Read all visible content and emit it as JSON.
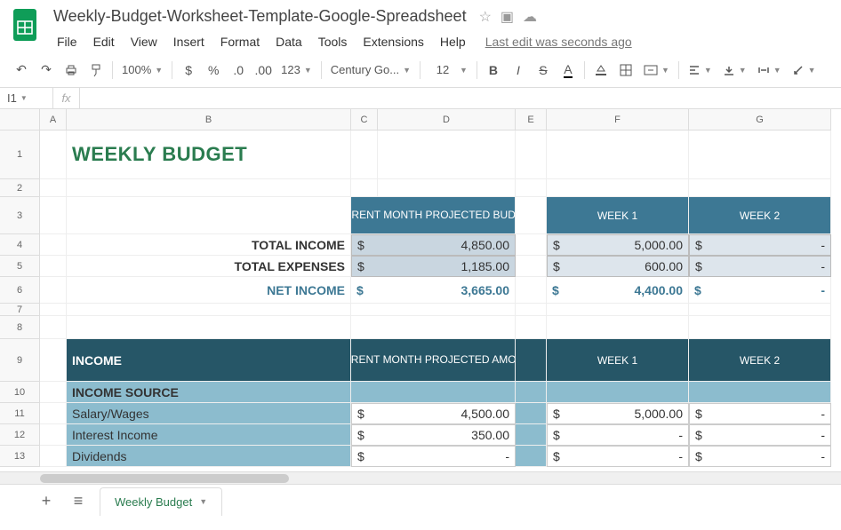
{
  "doc": {
    "title": "Weekly-Budget-Worksheet-Template-Google-Spreadsheet"
  },
  "menu": {
    "file": "File",
    "edit": "Edit",
    "view": "View",
    "insert": "Insert",
    "format": "Format",
    "data": "Data",
    "tools": "Tools",
    "extensions": "Extensions",
    "help": "Help",
    "last_edit": "Last edit was seconds ago"
  },
  "toolbar": {
    "zoom": "100%",
    "font": "Century Go...",
    "size": "12",
    "number_fmt": "123"
  },
  "namebox": "I1",
  "cols": {
    "A": "A",
    "B": "B",
    "C": "C",
    "D": "D",
    "E": "E",
    "F": "F",
    "G": "G"
  },
  "rows": [
    "1",
    "2",
    "3",
    "4",
    "5",
    "6",
    "7",
    "8",
    "9",
    "10",
    "11",
    "12",
    "13"
  ],
  "sheet": {
    "title": "WEEKLY BUDGET",
    "hdr_proj": "CURRENT MONTH PROJECTED BUDGET",
    "hdr_w1": "WEEK 1",
    "hdr_w2": "WEEK 2",
    "total_income_label": "TOTAL INCOME",
    "total_expenses_label": "TOTAL EXPENSES",
    "net_income_label": "NET INCOME",
    "ti_proj": "4,850.00",
    "ti_w1": "5,000.00",
    "ti_w2": "-",
    "te_proj": "1,185.00",
    "te_w1": "600.00",
    "te_w2": "-",
    "net_proj": "3,665.00",
    "net_w1": "4,400.00",
    "net_w2": "-",
    "income_hdr": "INCOME",
    "income_proj_hdr": "CURRENT MONTH PROJECTED AMOUNT",
    "income_w1_hdr": "WEEK 1",
    "income_w2_hdr": "WEEK 2",
    "income_source": "INCOME SOURCE",
    "salary_label": "Salary/Wages",
    "salary_proj": "4,500.00",
    "salary_w1": "5,000.00",
    "salary_w2": "-",
    "interest_label": "Interest Income",
    "interest_proj": "350.00",
    "interest_w1": "-",
    "interest_w2": "-",
    "dividends_label": "Dividends",
    "dividends_proj": "-",
    "dividends_w1": "-",
    "dividends_w2": "-",
    "dollar": "$"
  },
  "tabs": {
    "sheet_name": "Weekly Budget"
  }
}
